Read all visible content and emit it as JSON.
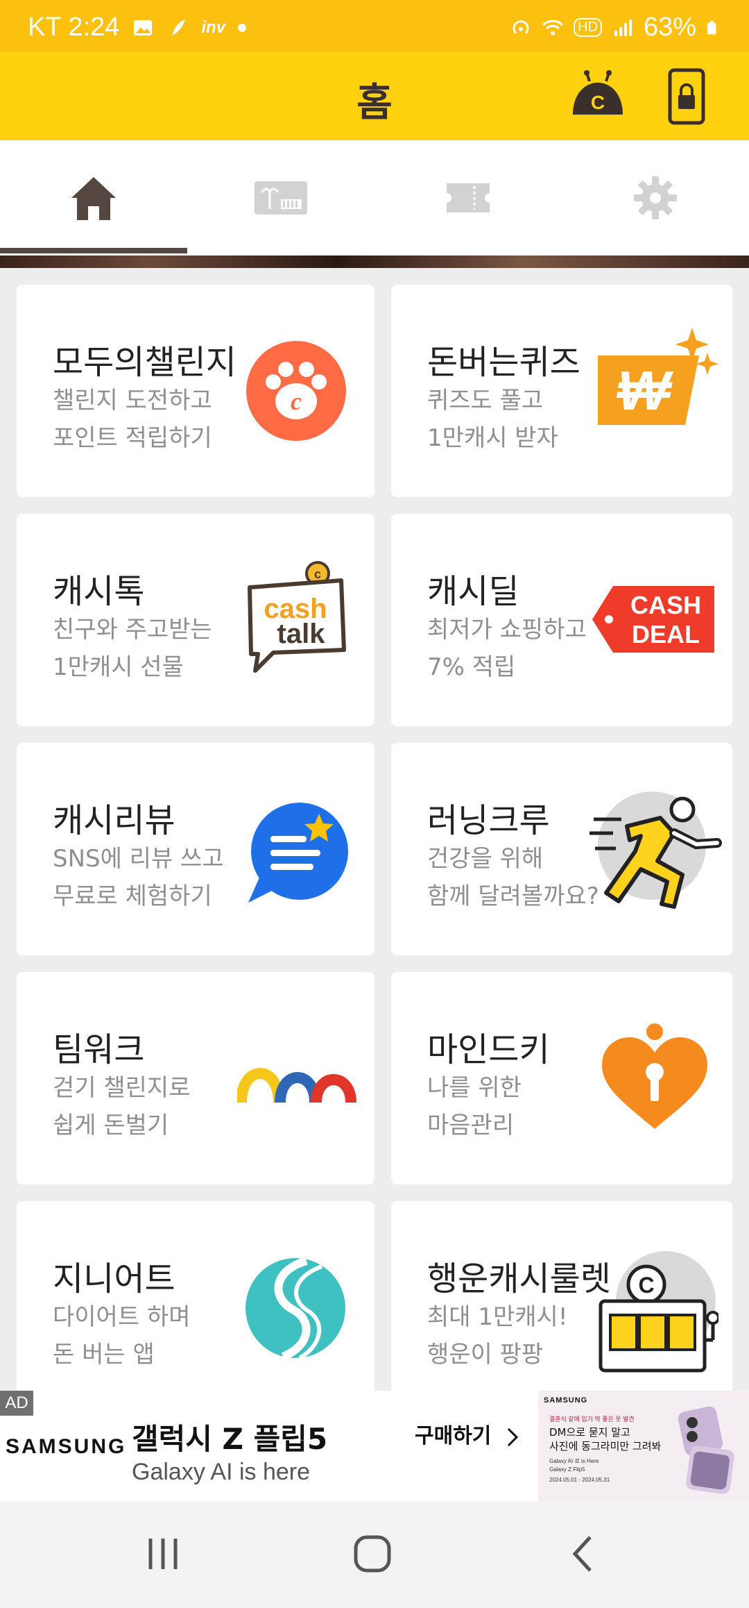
{
  "status_bar": {
    "carrier_time": "KT 2:24",
    "battery": "63%",
    "left_icons": [
      "gallery-icon",
      "feather-icon",
      "inv-icon",
      "dot-icon"
    ],
    "right_icons": [
      "hotspot-icon",
      "wifi-icon",
      "hd-icon",
      "signal-icon",
      "battery-icon"
    ]
  },
  "app_bar": {
    "title": "홈",
    "actions": [
      "robot-icon",
      "phone-lock-icon"
    ]
  },
  "tabs": [
    {
      "icon": "home-icon",
      "active": true
    },
    {
      "icon": "gift-card-icon",
      "active": false
    },
    {
      "icon": "ticket-icon",
      "active": false
    },
    {
      "icon": "gear-icon",
      "active": false
    }
  ],
  "colors": {
    "status_bar": "#fcc10e",
    "app_bar": "#ffd10e",
    "brown": "#554640",
    "inactive_icon": "#d2d2d2"
  },
  "cards": [
    {
      "title": "모두의챌린지",
      "line1": "챌린지 도전하고",
      "line2": "포인트 적립하기",
      "icon": "paw-icon"
    },
    {
      "title": "돈버는퀴즈",
      "line1": "퀴즈도 풀고",
      "line2": "1만캐시 받자",
      "icon": "won-sparkle-icon"
    },
    {
      "title": "캐시톡",
      "line1": "친구와 주고받는",
      "line2": "1만캐시 선물",
      "icon": "cash-talk-icon",
      "icon_text1": "cash",
      "icon_text2": "talk"
    },
    {
      "title": "캐시딜",
      "line1": "최저가 쇼핑하고",
      "line2": "7% 적립",
      "icon": "cash-deal-icon",
      "icon_text1": "CASH",
      "icon_text2": "DEAL"
    },
    {
      "title": "캐시리뷰",
      "line1": "SNS에 리뷰 쓰고",
      "line2": "무료로 체험하기",
      "icon": "review-bubble-icon"
    },
    {
      "title": "러닝크루",
      "line1": "건강을 위해",
      "line2": "함께 달려볼까요?",
      "icon": "runner-icon"
    },
    {
      "title": "팀워크",
      "line1": "걷기 챌린지로",
      "line2": "쉽게 돈벌기",
      "icon": "arches-icon"
    },
    {
      "title": "마인드키",
      "line1": "나를 위한",
      "line2": "마음관리",
      "icon": "heart-keyhole-icon"
    },
    {
      "title": "지니어트",
      "line1": "다이어트 하며",
      "line2": "돈 버는 앱",
      "icon": "s-wave-icon"
    },
    {
      "title": "행운캐시룰렛",
      "line1": "최대 1만캐시!",
      "line2": "행운이 팡팡",
      "icon": "slot-machine-icon"
    }
  ],
  "ad": {
    "badge": "AD",
    "brand": "SAMSUNG",
    "title": "갤럭시 Z 플립5",
    "subtitle": "Galaxy AI is here",
    "cta": "구매하기",
    "image": {
      "brand": "SAMSUNG",
      "red_line": "결혼식 같애 입기 딱 좋은 옷 발견",
      "msg1": "DM으로 묻지 말고",
      "msg2": "사진에 동그라미만 그려봐",
      "small1": "Galaxy AI 로 is Here",
      "small2": "Galaxy Z Flip5",
      "date": "2024.05.01 - 2024.05.31"
    }
  },
  "nav_bar": [
    "recent-apps-icon",
    "home-circle-icon",
    "back-icon"
  ]
}
